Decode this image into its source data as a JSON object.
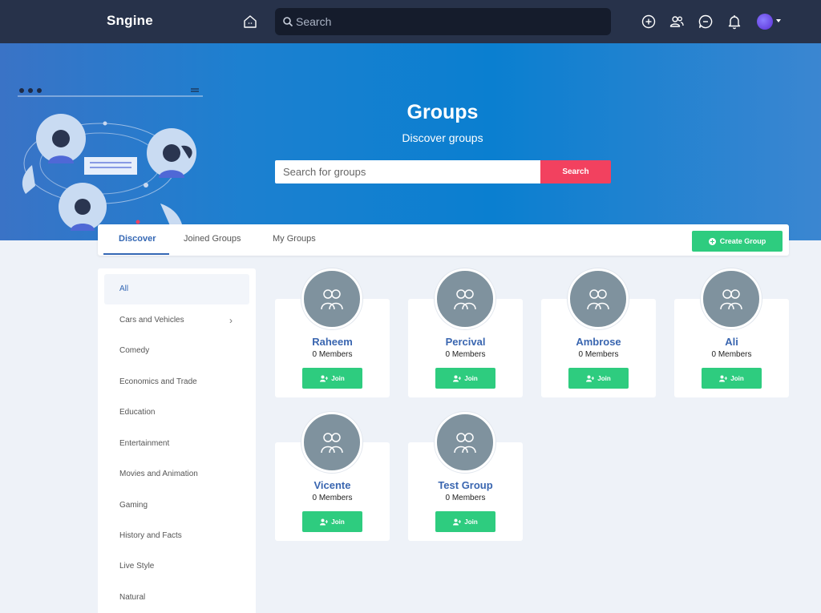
{
  "navbar": {
    "brand": "Sngine",
    "search_placeholder": "Search",
    "icons": [
      "home-icon",
      "create-plus-icon",
      "friends-icon",
      "messages-icon",
      "notifications-bell-icon"
    ]
  },
  "hero": {
    "title": "Groups",
    "subtitle": "Discover groups",
    "search_placeholder": "Search for groups",
    "search_button": "Search"
  },
  "tabs": [
    {
      "label": "Discover",
      "active": true
    },
    {
      "label": "Joined Groups",
      "active": false
    },
    {
      "label": "My Groups",
      "active": false
    }
  ],
  "create_group_label": "Create Group",
  "categories": [
    {
      "label": "All",
      "active": true
    },
    {
      "label": "Cars and Vehicles",
      "has_children": true
    },
    {
      "label": "Comedy"
    },
    {
      "label": "Economics and Trade"
    },
    {
      "label": "Education"
    },
    {
      "label": "Entertainment"
    },
    {
      "label": "Movies and Animation"
    },
    {
      "label": "Gaming"
    },
    {
      "label": "History and Facts"
    },
    {
      "label": "Live Style"
    },
    {
      "label": "Natural"
    }
  ],
  "groups": [
    {
      "name": "Raheem",
      "members": "0 Members",
      "join_label": "Join"
    },
    {
      "name": "Percival",
      "members": "0 Members",
      "join_label": "Join"
    },
    {
      "name": "Ambrose",
      "members": "0 Members",
      "join_label": "Join"
    },
    {
      "name": "Ali",
      "members": "0 Members",
      "join_label": "Join"
    },
    {
      "name": "Vicente",
      "members": "0 Members",
      "join_label": "Join"
    },
    {
      "name": "Test Group",
      "members": "0 Members",
      "join_label": "Join"
    }
  ],
  "colors": {
    "navbar_bg": "#27324a",
    "accent_blue": "#3467b4",
    "join_green": "#2ecc7f",
    "search_red": "#f2415f"
  }
}
